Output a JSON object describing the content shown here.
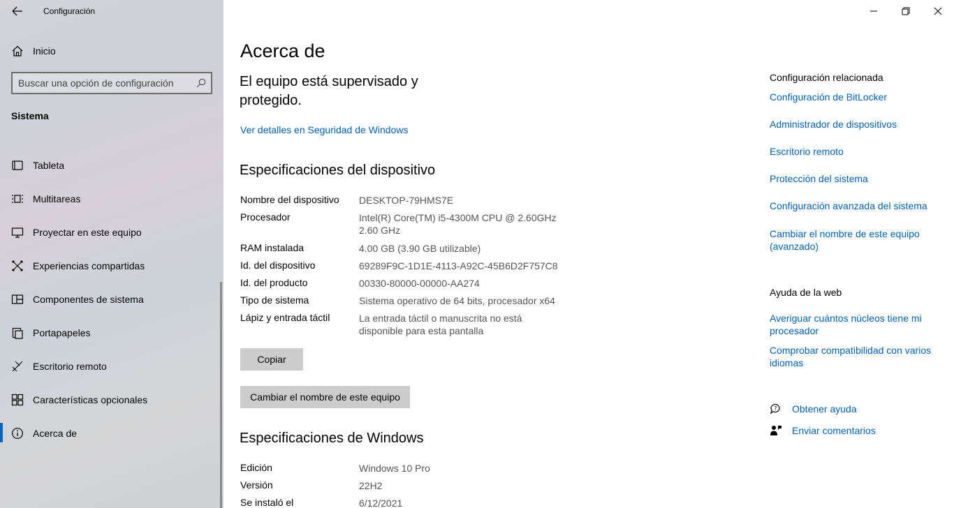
{
  "window": {
    "title": "Configuración"
  },
  "sidebar": {
    "home_label": "Inicio",
    "search_placeholder": "Buscar una opción de configuración",
    "section": "Sistema",
    "items": [
      {
        "label": "Tableta",
        "icon": "tablet-icon"
      },
      {
        "label": "Multitareas",
        "icon": "multitask-icon"
      },
      {
        "label": "Proyectar en este equipo",
        "icon": "project-icon"
      },
      {
        "label": "Experiencias compartidas",
        "icon": "shared-icon"
      },
      {
        "label": "Componentes de sistema",
        "icon": "components-icon"
      },
      {
        "label": "Portapapeles",
        "icon": "clipboard-icon"
      },
      {
        "label": "Escritorio remoto",
        "icon": "remote-desktop-icon"
      },
      {
        "label": "Características opcionales",
        "icon": "optional-features-icon"
      },
      {
        "label": "Acerca de",
        "icon": "info-icon",
        "active": true
      }
    ]
  },
  "main": {
    "title": "Acerca de",
    "protection_text": "El equipo está supervisado y protegido.",
    "security_link": "Ver detalles en Seguridad de Windows",
    "device_specs_title": "Especificaciones del dispositivo",
    "device_specs": [
      {
        "key": "Nombre del dispositivo",
        "value": "DESKTOP-79HMS7E"
      },
      {
        "key": "Procesador",
        "value": "Intel(R) Core(TM) i5-4300M CPU @ 2.60GHz",
        "value2": "2.60 GHz"
      },
      {
        "key": "RAM instalada",
        "value": "4.00 GB (3.90 GB utilizable)"
      },
      {
        "key": "Id. del dispositivo",
        "value": "69289F9C-1D1E-4113-A92C-45B6D2F757C8"
      },
      {
        "key": "Id. del producto",
        "value": "00330-80000-00000-AA274"
      },
      {
        "key": "Tipo de sistema",
        "value": "Sistema operativo de 64 bits, procesador x64"
      },
      {
        "key": "Lápiz y entrada táctil",
        "value": "La entrada táctil o manuscrita no está",
        "value2": "disponible para esta pantalla"
      }
    ],
    "copy_button": "Copiar",
    "rename_button": "Cambiar el nombre de este equipo",
    "windows_specs_title": "Especificaciones de Windows",
    "windows_specs": [
      {
        "key": "Edición",
        "value": "Windows 10 Pro"
      },
      {
        "key": "Versión",
        "value": "22H2"
      },
      {
        "key": "Se instaló el",
        "value": "6/12/2021"
      }
    ]
  },
  "related": {
    "title": "Configuración relacionada",
    "links": [
      "Configuración de BitLocker",
      "Administrador de dispositivos",
      "Escritorio remoto",
      "Protección del sistema",
      "Configuración avanzada del sistema",
      "Cambiar el nombre de este equipo (avanzado)"
    ],
    "web_title": "Ayuda de la web",
    "web_links": [
      "Averiguar cuántos núcleos tiene mi procesador",
      "Comprobar compatibilidad con varios idiomas"
    ],
    "help_label": "Obtener ayuda",
    "feedback_label": "Enviar comentarios"
  },
  "colors": {
    "accent": "#0067c0",
    "link": "#0062ad",
    "button_bg": "#cccccc"
  }
}
